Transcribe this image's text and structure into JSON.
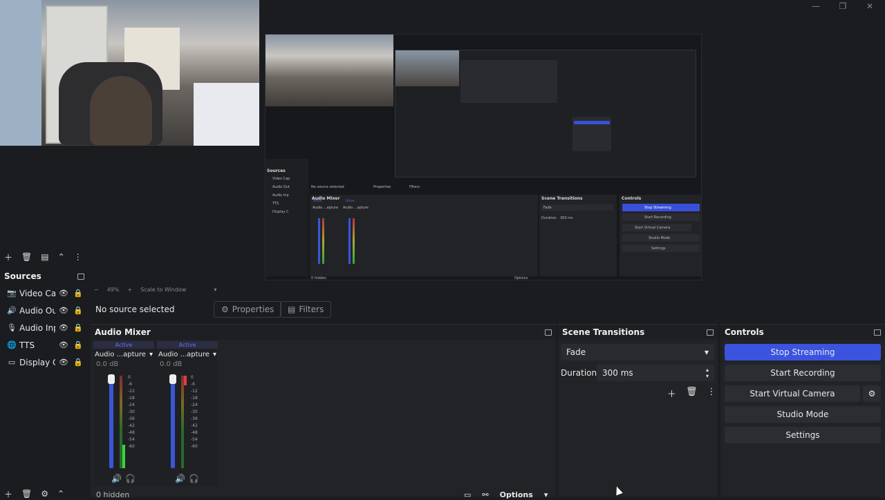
{
  "window": {
    "minimize": "—",
    "restore": "❐",
    "close": "✕"
  },
  "preview": {
    "zoom": "49%",
    "scale_mode": "Scale to Window",
    "inner_sources_title": "Sources",
    "inner_sources": [
      "Video Cap",
      "Audio Out",
      "Audio Inp",
      "TTS",
      "Display C"
    ],
    "inner_no_source": "No source selected",
    "inner_properties": "Properties",
    "inner_filters": "Filters",
    "inner_audio_mixer": "Audio Mixer",
    "inner_scene_transitions": "Scene Transitions",
    "inner_fade": "Fade",
    "inner_duration": "Duration",
    "inner_duration_value": "300 ms",
    "inner_controls": "Controls",
    "inner_buttons": [
      "Stop Streaming",
      "Start Recording",
      "Start Virtual Camera",
      "Studio Mode",
      "Settings"
    ],
    "inner_mixer_names": [
      "Audio ...apture",
      "Audio ...apture"
    ],
    "inner_active": [
      "Active",
      "Active"
    ],
    "inner_hidden": "0 hidden",
    "inner_options": "Options"
  },
  "sources": {
    "title": "Sources",
    "items": [
      {
        "label": "Video Cap",
        "icon": "camera-icon"
      },
      {
        "label": "Audio Out",
        "icon": "speaker-icon"
      },
      {
        "label": "Audio Inp",
        "icon": "microphone-icon"
      },
      {
        "label": "TTS",
        "icon": "globe-icon"
      },
      {
        "label": "Display C",
        "icon": "monitor-icon"
      }
    ]
  },
  "source_bar": {
    "status": "No source selected",
    "properties": "Properties",
    "filters": "Filters"
  },
  "mixer": {
    "title": "Audio Mixer",
    "channels": [
      {
        "active": "Active",
        "name": "Audio ...apture",
        "db": "0.0 dB"
      },
      {
        "active": "Active",
        "name": "Audio ...apture",
        "db": "0.0 dB"
      }
    ],
    "scale": [
      "0",
      "-6",
      "-12",
      "-18",
      "-24",
      "-30",
      "-36",
      "-42",
      "-48",
      "-54",
      "-60"
    ],
    "hidden": "0 hidden",
    "options": "Options"
  },
  "transitions": {
    "title": "Scene Transitions",
    "selected": "Fade",
    "duration_label": "Duration",
    "duration_value": "300 ms"
  },
  "controls": {
    "title": "Controls",
    "stop_streaming": "Stop Streaming",
    "start_recording": "Start Recording",
    "start_virtual_camera": "Start Virtual Camera",
    "studio_mode": "Studio Mode",
    "settings": "Settings"
  },
  "colors": {
    "accent": "#3a54e0",
    "panel": "#222327",
    "background": "#1b1c20"
  }
}
